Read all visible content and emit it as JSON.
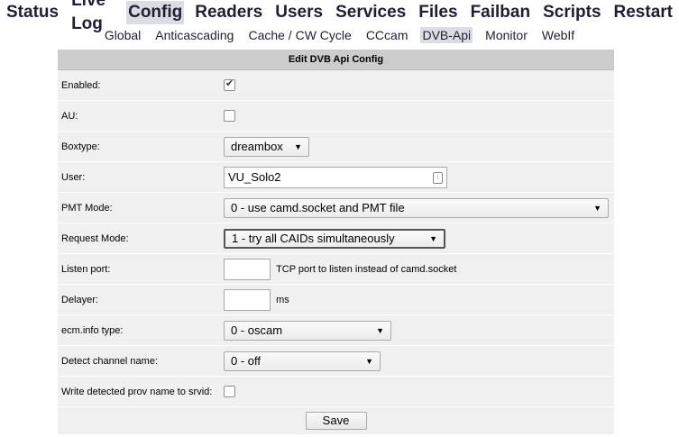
{
  "main_menu": [
    {
      "label": "Status",
      "active": false
    },
    {
      "label": "Live Log",
      "active": false
    },
    {
      "label": "Config",
      "active": true
    },
    {
      "label": "Readers",
      "active": false
    },
    {
      "label": "Users",
      "active": false
    },
    {
      "label": "Services",
      "active": false
    },
    {
      "label": "Files",
      "active": false
    },
    {
      "label": "Failban",
      "active": false
    },
    {
      "label": "Scripts",
      "active": false
    },
    {
      "label": "Restart",
      "active": false
    }
  ],
  "sub_menu": [
    {
      "label": "Global",
      "active": false
    },
    {
      "label": "Anticascading",
      "active": false
    },
    {
      "label": "Cache / CW Cycle",
      "active": false
    },
    {
      "label": "CCcam",
      "active": false
    },
    {
      "label": "DVB-Api",
      "active": true
    },
    {
      "label": "Monitor",
      "active": false
    },
    {
      "label": "WebIf",
      "active": false
    }
  ],
  "form": {
    "title": "Edit DVB Api Config",
    "enabled": {
      "label": "Enabled:",
      "checked": true
    },
    "au": {
      "label": "AU:",
      "checked": false
    },
    "boxtype": {
      "label": "Boxtype:",
      "value": "dreambox"
    },
    "user": {
      "label": "User:",
      "value": "VU_Solo2"
    },
    "pmt_mode": {
      "label": "PMT Mode:",
      "value": "0 - use camd.socket and PMT file"
    },
    "request_mode": {
      "label": "Request Mode:",
      "value": "1 - try all CAIDs simultaneously"
    },
    "listen_port": {
      "label": "Listen port:",
      "value": "",
      "hint": "TCP port to listen instead of camd.socket"
    },
    "delayer": {
      "label": "Delayer:",
      "value": "",
      "unit": "ms"
    },
    "ecminfo_type": {
      "label": "ecm.info type:",
      "value": "0 - oscam"
    },
    "detect_channel": {
      "label": "Detect channel name:",
      "value": "0 - off"
    },
    "write_prov": {
      "label": "Write detected prov name to srvid:",
      "checked": false
    },
    "save_label": "Save"
  }
}
